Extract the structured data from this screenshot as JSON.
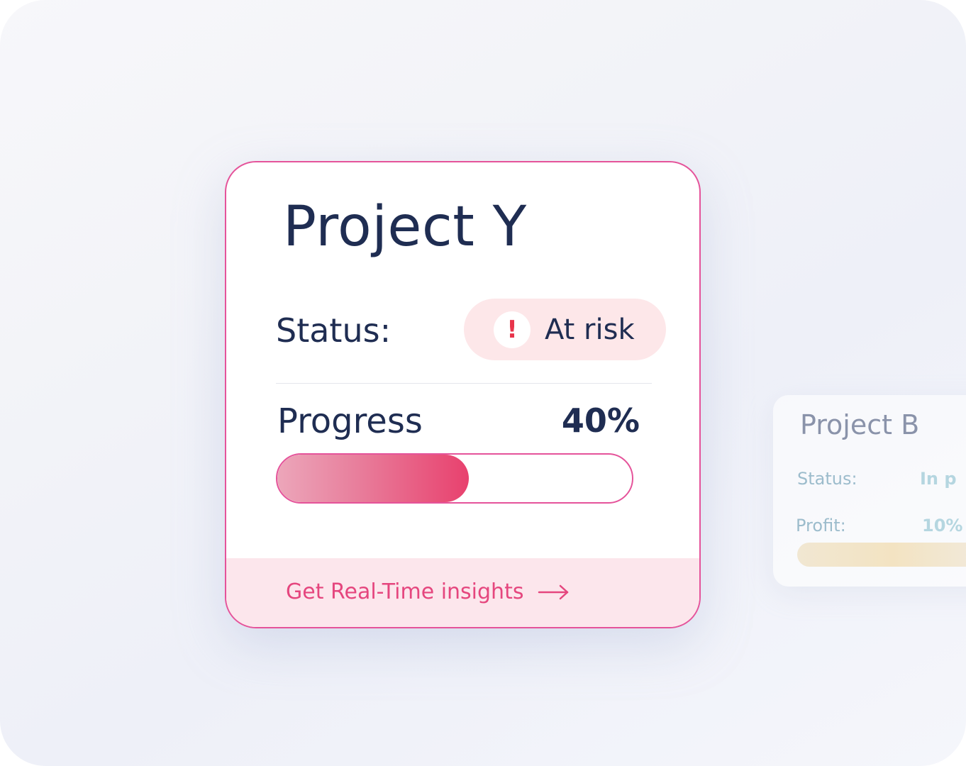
{
  "main_card": {
    "title": "Project Y",
    "status_label": "Status:",
    "status_badge": {
      "icon": "alert-icon",
      "icon_glyph": "!",
      "label": "At risk",
      "color": "#e8344b"
    },
    "progress_label": "Progress",
    "progress_value": "40%",
    "progress_fraction": 0.54,
    "cta_label": "Get Real-Time insights",
    "cta_icon": "arrow-right-icon",
    "accent_color": "#e5539a"
  },
  "secondary_card": {
    "title": "Project B",
    "status_label": "Status:",
    "status_value": "In p",
    "profit_label": "Profit:",
    "profit_value": "10%"
  }
}
